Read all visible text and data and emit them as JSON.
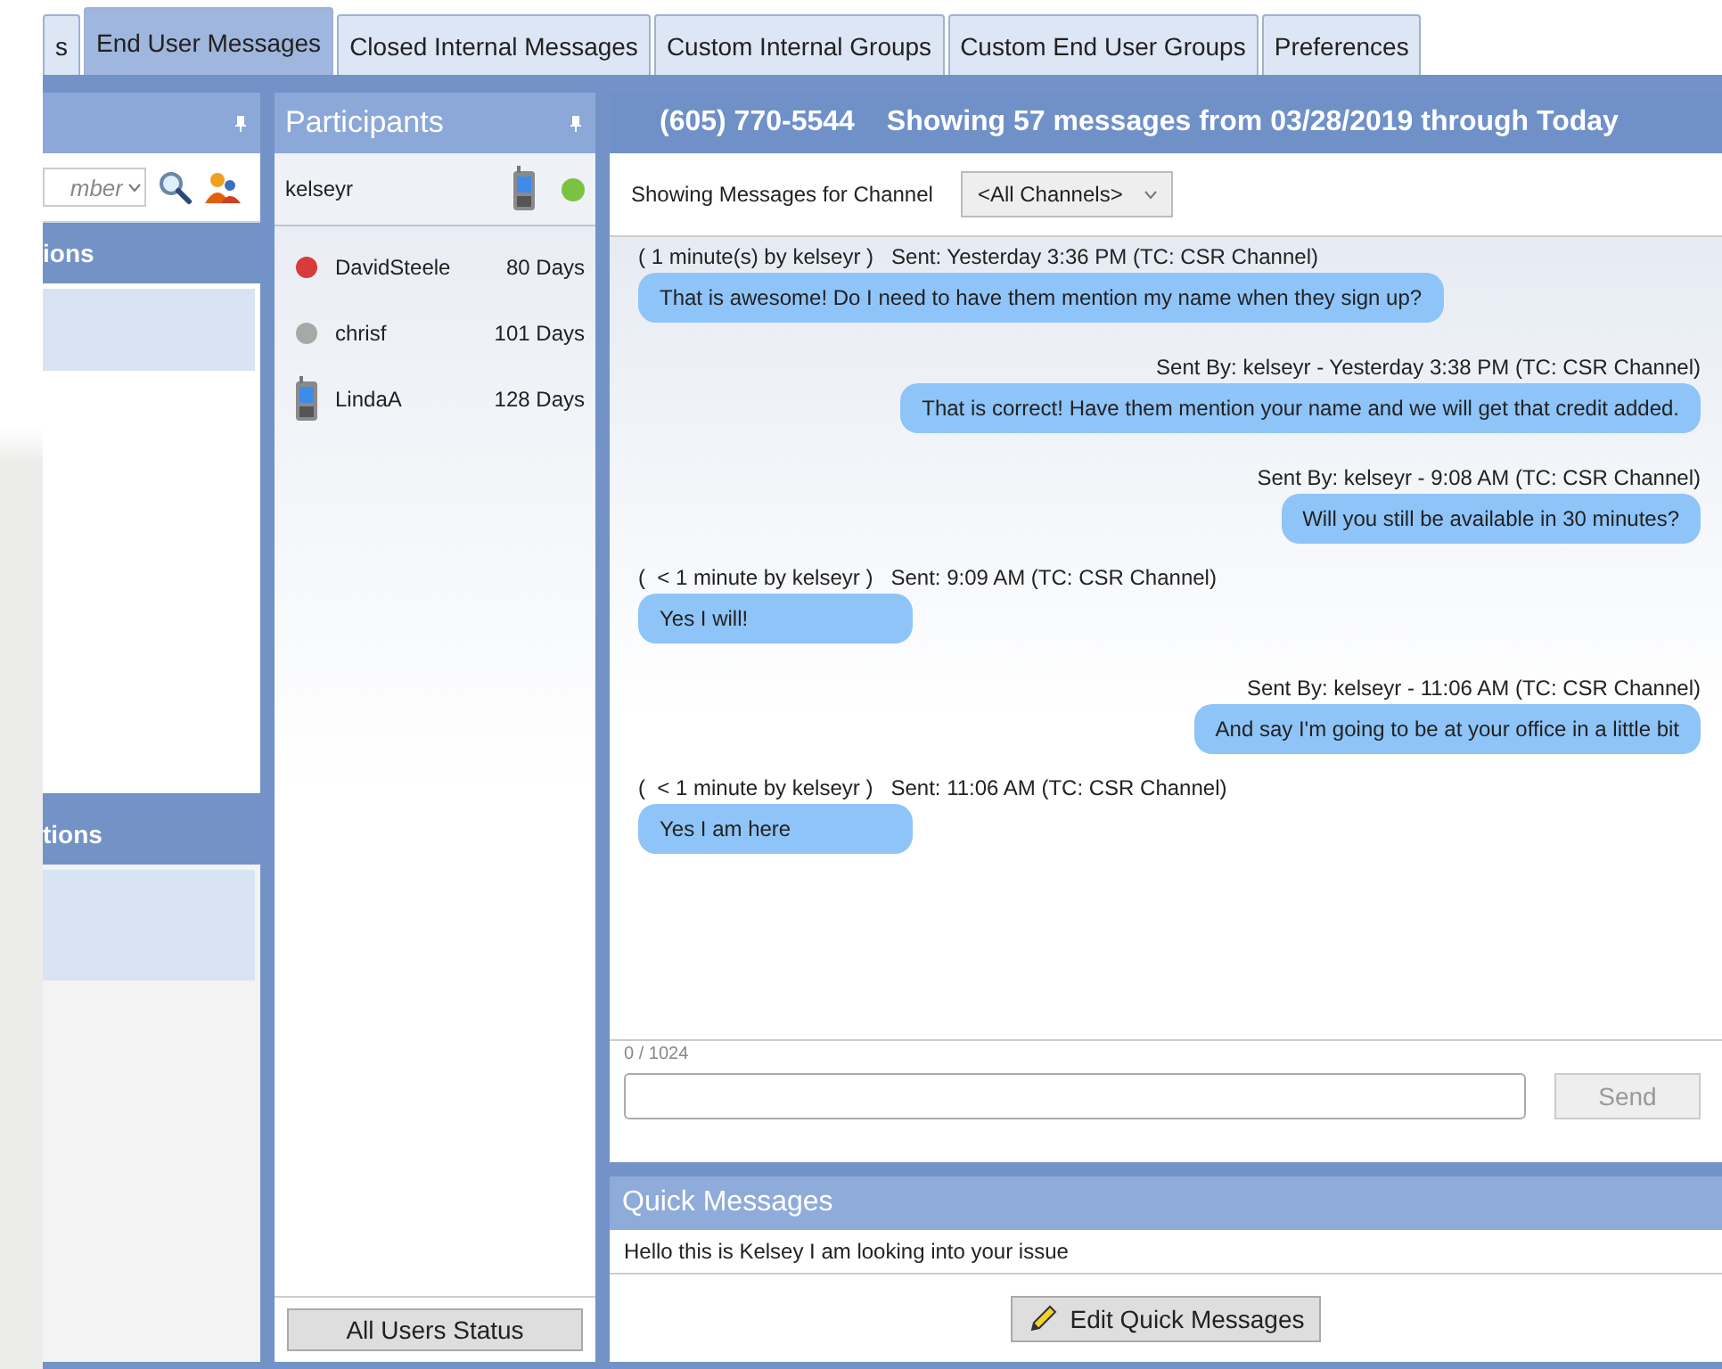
{
  "tabs": [
    {
      "label": "s",
      "selected": false
    },
    {
      "label": "End User Messages",
      "selected": true
    },
    {
      "label": "Closed Internal Messages",
      "selected": false
    },
    {
      "label": "Custom Internal Groups",
      "selected": false
    },
    {
      "label": "Custom End User Groups",
      "selected": false
    },
    {
      "label": "Preferences",
      "selected": false
    }
  ],
  "left_panel": {
    "search": {
      "placeholder": "mber"
    },
    "sections": [
      {
        "title": "ions"
      },
      {
        "title": "tions"
      }
    ]
  },
  "participants": {
    "title": "Participants",
    "current_user": {
      "name": "kelseyr",
      "kind": "phone",
      "color": "#7cc242"
    },
    "items": [
      {
        "name": "DavidSteele",
        "age": "80 Days",
        "kind": "dot",
        "color": "#d93a3a"
      },
      {
        "name": "chrisf",
        "age": "101 Days",
        "kind": "dot",
        "color": "#a8a8a8"
      },
      {
        "name": "LindaA",
        "age": "128 Days",
        "kind": "phone"
      }
    ],
    "button": "All Users Status"
  },
  "chat": {
    "phone": "(605) 770-5544",
    "summary": "Showing 57 messages from 03/28/2019 through Today",
    "channel_label": "Showing Messages for Channel",
    "channel": "<All Channels>",
    "messages": [
      {
        "kind": "incoming",
        "meta": "( 1 minute(s) by kelseyr )   Sent: Yesterday 3:36 PM (TC: CSR Channel)",
        "text": "That is awesome! Do I need to have them mention my name when they sign up?"
      },
      {
        "kind": "outgoing",
        "meta": "Sent By: kelseyr - Yesterday 3:38 PM (TC: CSR Channel)",
        "text": "That is correct! Have them mention your name and we will get that credit added."
      },
      {
        "kind": "outgoing",
        "meta": "Sent By: kelseyr - 9:08 AM (TC: CSR Channel)",
        "text": "Will you still be available in 30 minutes?"
      },
      {
        "kind": "incoming",
        "meta": "(  < 1 minute by kelseyr )   Sent: 9:09 AM (TC: CSR Channel)",
        "text": "Yes I will!"
      },
      {
        "kind": "outgoing",
        "meta": "Sent By: kelseyr - 11:06 AM (TC: CSR Channel)",
        "text": "And say I'm going to be at your office in a little bit"
      },
      {
        "kind": "incoming",
        "meta": "(  < 1 minute by kelseyr )   Sent: 11:06 AM (TC: CSR Channel)",
        "text": "Yes I am here"
      }
    ],
    "counter": "0 / 1024",
    "send": {
      "label": "Send",
      "disabled": true
    }
  },
  "quick_messages": {
    "title": "Quick Messages",
    "items": [
      "Hello this is Kelsey I am looking into your issue"
    ],
    "button": "Edit Quick Messages"
  }
}
